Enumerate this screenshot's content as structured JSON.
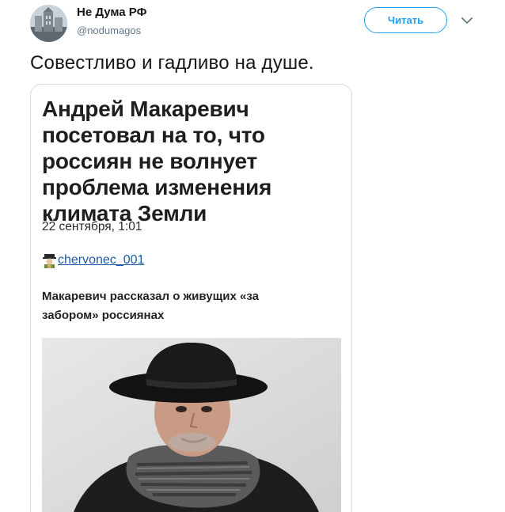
{
  "tweet": {
    "author_name": "Не Дума РФ",
    "author_handle": "@nodumagos",
    "follow_label": "Читать",
    "text": "Совестливо и гадливо на душе."
  },
  "screenshot": {
    "headline_lines": [
      "Андрей Макаревич",
      "посетовал на то, что",
      "россиян не волнует",
      "проблема изменения",
      "климата Земли"
    ],
    "date": "22 сентября, 1:01",
    "username": "chervonec_001",
    "subheadline_lines": [
      "Макаревич рассказал о живущих «за",
      "забором» россиянах"
    ]
  },
  "colors": {
    "accent": "#1da1f2",
    "link": "#1b5aa6",
    "secondary_text": "#657786"
  }
}
